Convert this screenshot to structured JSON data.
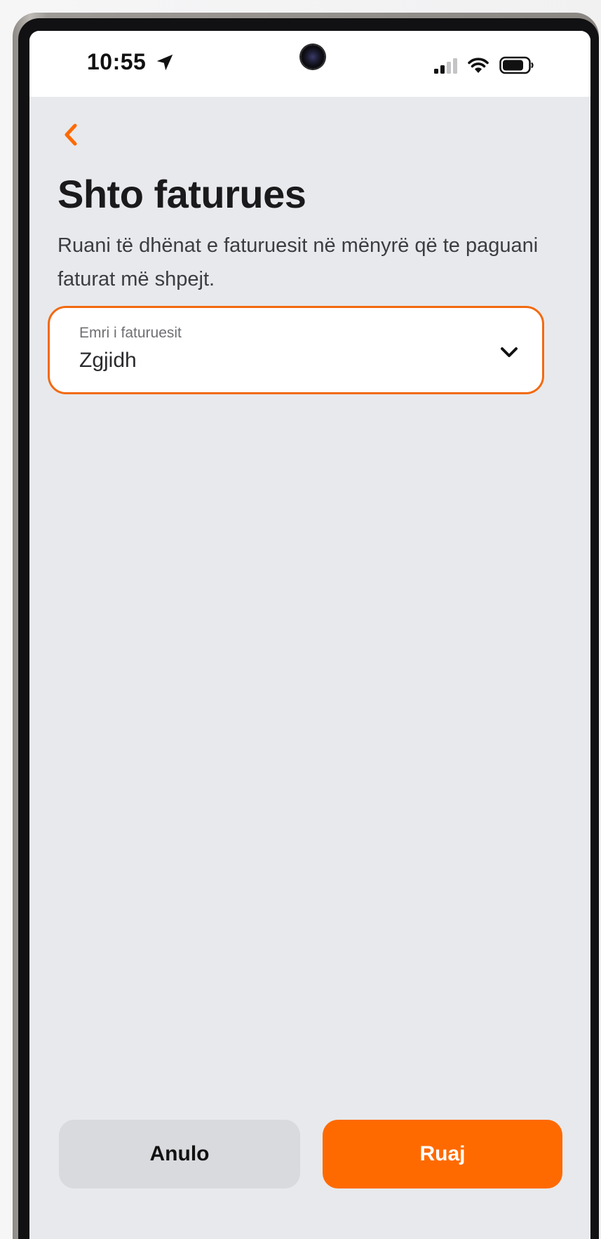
{
  "status_bar": {
    "time": "10:55",
    "icons": [
      "location-arrow-icon",
      "front-camera",
      "cellular-signal-icon",
      "wifi-icon",
      "battery-icon"
    ]
  },
  "header": {
    "back_icon": "chevron-left-icon",
    "title": "Shto faturues",
    "subtitle": "Ruani të dhënat e faturuesit në mënyrë që te paguani faturat më shpejt."
  },
  "form": {
    "biller_field": {
      "label": "Emri i faturuesit",
      "value": "Zgjidh",
      "icon": "chevron-down-icon"
    }
  },
  "actions": {
    "cancel_label": "Anulo",
    "save_label": "Ruaj"
  },
  "colors": {
    "accent": "#ff6a00",
    "field_border": "#f26a10",
    "screen_background": "#e8e9ec",
    "cancel_background": "#d9dadd"
  }
}
